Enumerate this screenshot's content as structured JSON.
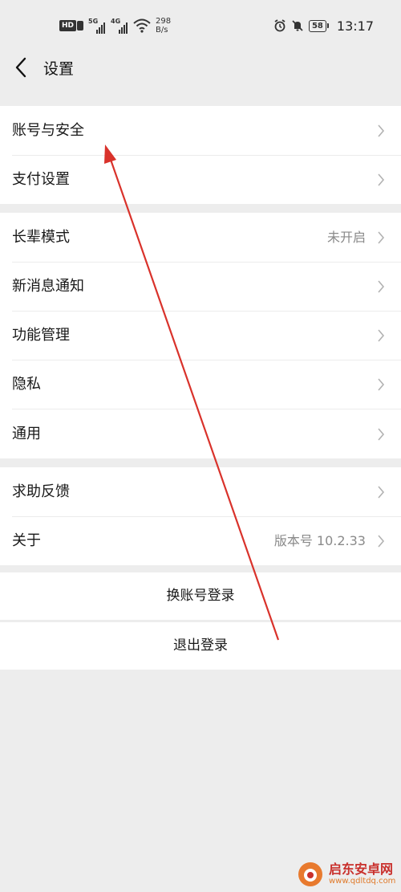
{
  "status_bar": {
    "hd_label": "HD",
    "net1": "5G",
    "net2": "4G",
    "speed_value": "298",
    "speed_unit": "B/s",
    "battery": "58",
    "time": "13:17"
  },
  "nav": {
    "title": "设置",
    "back_icon": "chevron-left-icon"
  },
  "groups": [
    {
      "items": [
        {
          "label": "账号与安全",
          "value": ""
        },
        {
          "label": "支付设置",
          "value": ""
        }
      ]
    },
    {
      "items": [
        {
          "label": "长辈模式",
          "value": "未开启"
        },
        {
          "label": "新消息通知",
          "value": ""
        },
        {
          "label": "功能管理",
          "value": ""
        },
        {
          "label": "隐私",
          "value": ""
        },
        {
          "label": "通用",
          "value": ""
        }
      ]
    },
    {
      "items": [
        {
          "label": "求助反馈",
          "value": ""
        },
        {
          "label": "关于",
          "value": "版本号 10.2.33"
        }
      ]
    }
  ],
  "buttons": {
    "switch_account": "换账号登录",
    "logout": "退出登录"
  },
  "annotation": {
    "color": "#d9322b"
  },
  "watermark": {
    "name": "启东安卓网",
    "url": "www.qdltdq.com"
  },
  "colors": {
    "background": "#ededed",
    "card": "#ffffff",
    "secondary_text": "#8a8a8a"
  }
}
